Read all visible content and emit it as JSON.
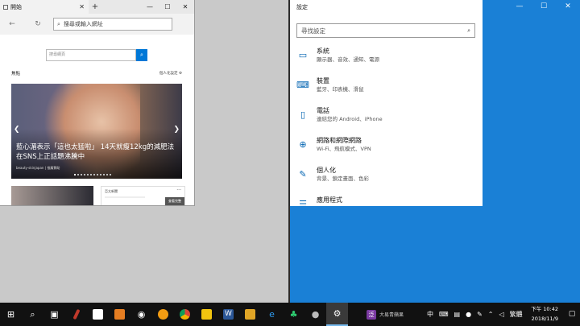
{
  "edge": {
    "tab_title": "開始",
    "new_tab": "+",
    "address_placeholder": "搜尋或輸入網址",
    "page_search_placeholder": "搜尋網頁",
    "page_search_button": "⌕",
    "feed_title": "焦點",
    "feed_right": "個人化設定",
    "hero_title": "藍心湄表示「這也太猛啦」 14天就瘦12kg的減肥法在SNS上正話題沸騰中",
    "hero_source": "beauty-skinjapan | 推薦贊助",
    "card_source": "亞太新聞",
    "card_more": "···",
    "card_button": "查看完整"
  },
  "window_controls": {
    "minimize": "—",
    "maximize": "☐",
    "close": "✕"
  },
  "settings": {
    "title": "設定",
    "search_placeholder": "尋找設定",
    "items": [
      {
        "icon": "laptop-icon",
        "glyph": "▭",
        "title": "系統",
        "subtitle": "顯示器、音效、通知、電源"
      },
      {
        "icon": "keyboard-icon",
        "glyph": "⌨",
        "title": "裝置",
        "subtitle": "藍牙、印表機、滑鼠"
      },
      {
        "icon": "phone-icon",
        "glyph": "▯",
        "title": "電話",
        "subtitle": "連結您的 Android、iPhone"
      },
      {
        "icon": "globe-icon",
        "glyph": "⊕",
        "title": "網路和網際網路",
        "subtitle": "Wi-Fi、飛航模式、VPN"
      },
      {
        "icon": "paintbrush-icon",
        "glyph": "✎",
        "title": "個人化",
        "subtitle": "背景、鎖定畫面、色彩"
      },
      {
        "icon": "apps-list-icon",
        "glyph": "☰",
        "title": "應用程式",
        "subtitle": ""
      }
    ]
  },
  "taskbar": {
    "ime_label": "泛",
    "ime_text": "大易青蘋果",
    "input_mode": "中",
    "keyboard_label": "繁體",
    "time": "下午 10:42",
    "date": "2018/11/9"
  },
  "colors": {
    "accent": "#0078d7",
    "taskbar": "#111111",
    "settings_icon": "#0063b1"
  }
}
